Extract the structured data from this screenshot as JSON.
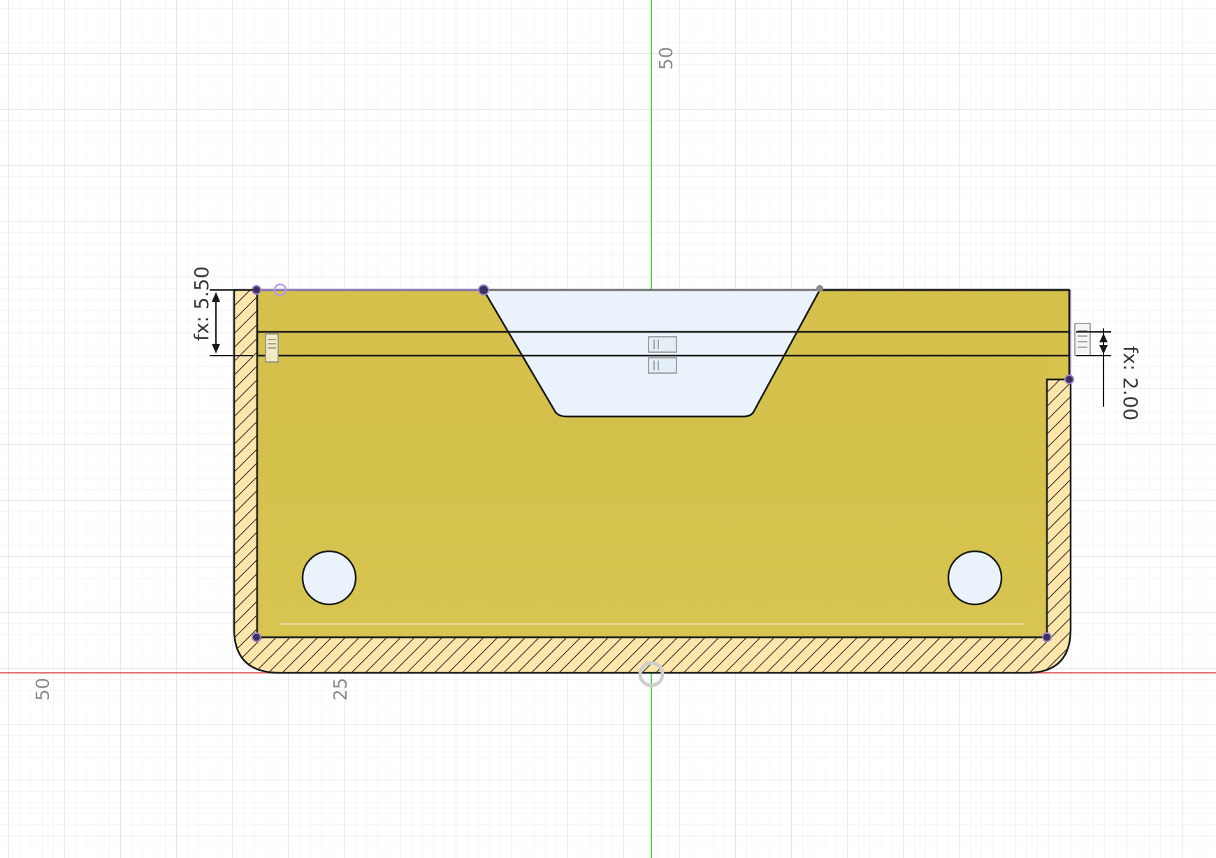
{
  "viewport": {
    "background": "#ffffff",
    "grid_minor_color": "#e9eaec",
    "grid_major_color": "#d3d5d8",
    "x_axis_color": "#e26d6d",
    "y_axis_color": "#54d654"
  },
  "rulers": {
    "vertical_axis_label": "50",
    "horizontal_left_far_label": "50",
    "horizontal_left_near_label": "25"
  },
  "dimensions": {
    "left_height": "fx: 5.50",
    "right_height": "fx: 2.00"
  },
  "colors": {
    "profile_fill": "#d8c44a",
    "section_hatch_bg": "#fde6ab",
    "pocket_fill": "#e8f2fb",
    "outline": "#1a1a1a",
    "constraint_purple": "#7a5ea8"
  },
  "icons": {
    "left_constraint": "horizontal-constraint-icon",
    "center_constraint": "symmetric-constraint-icon",
    "right_constraint": "horizontal-constraint-icon",
    "origin": "origin-point-icon"
  }
}
